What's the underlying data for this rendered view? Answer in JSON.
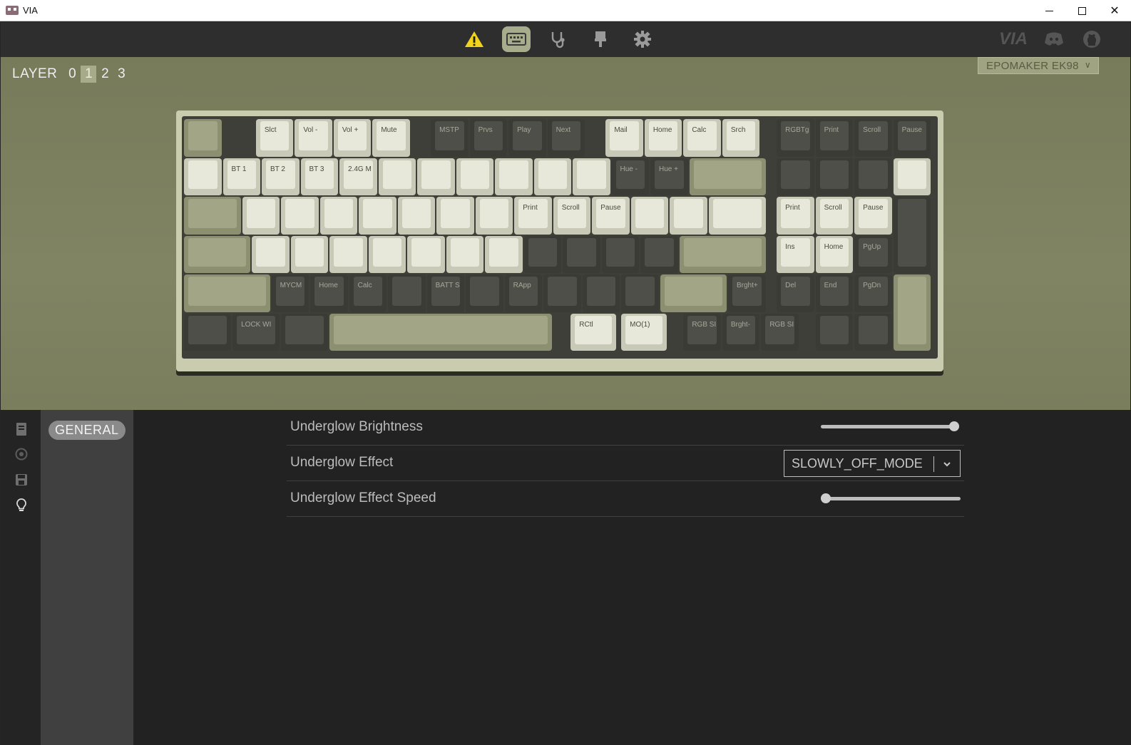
{
  "window": {
    "title": "VIA"
  },
  "topnav": {
    "items": [
      "warning-icon",
      "keyboard-icon",
      "stethoscope-icon",
      "brush-icon",
      "gear-icon"
    ],
    "right": {
      "via": "VIA",
      "discord": "discord-icon",
      "github": "github-icon"
    }
  },
  "layers": {
    "label": "LAYER",
    "items": [
      "0",
      "1",
      "2",
      "3"
    ],
    "selected": "1"
  },
  "device": {
    "name": "EPOMAKER EK98"
  },
  "keyboard": {
    "rows": [
      [
        "",
        "Slct",
        "Vol -",
        "Vol +",
        "Mute",
        "MSTP",
        "Prvs",
        "Play",
        "Next",
        "Mail",
        "Home",
        "Calc",
        "Srch",
        "RGBTg",
        "Print",
        "Scroll",
        "Pause"
      ],
      [
        "",
        "BT 1",
        "BT 2",
        "BT 3",
        "2.4G M",
        "",
        "",
        "",
        "",
        "",
        "",
        "Hue -",
        "Hue +",
        "",
        "",
        "",
        "",
        ""
      ],
      [
        "",
        "",
        "",
        "",
        "",
        "",
        "",
        "",
        "Print",
        "Scroll",
        "Pause",
        "",
        "",
        "",
        "Print",
        "Scroll",
        "Pause",
        ""
      ],
      [
        "",
        "",
        "",
        "",
        "",
        "",
        "",
        "",
        "",
        "",
        "",
        "",
        "",
        "Ins",
        "Home",
        "PgUp"
      ],
      [
        "",
        "MYCM",
        "Home",
        "Calc",
        "",
        "BATT S",
        "",
        "RApp",
        "",
        "",
        "",
        "",
        "Brght+",
        "Del",
        "End",
        "PgDn",
        ""
      ],
      [
        "",
        "LOCK WI",
        "",
        "",
        "RCtl",
        "MO(1)",
        "RGB SI",
        "Brght-",
        "RGB SI",
        "",
        ""
      ]
    ]
  },
  "sidebar": {
    "icons": [
      "keymap-icon",
      "macro-icon",
      "save-icon",
      "lighting-icon"
    ]
  },
  "category": {
    "label": "GENERAL"
  },
  "settings": {
    "brightness": {
      "label": "Underglow Brightness",
      "value": 1.0
    },
    "effect": {
      "label": "Underglow Effect",
      "value": "SLOWLY_OFF_MODE"
    },
    "speed": {
      "label": "Underglow Effect Speed",
      "value": 0.0
    }
  },
  "colors": {
    "accent": "#a7ac8c",
    "warning": "#f2d21b"
  }
}
